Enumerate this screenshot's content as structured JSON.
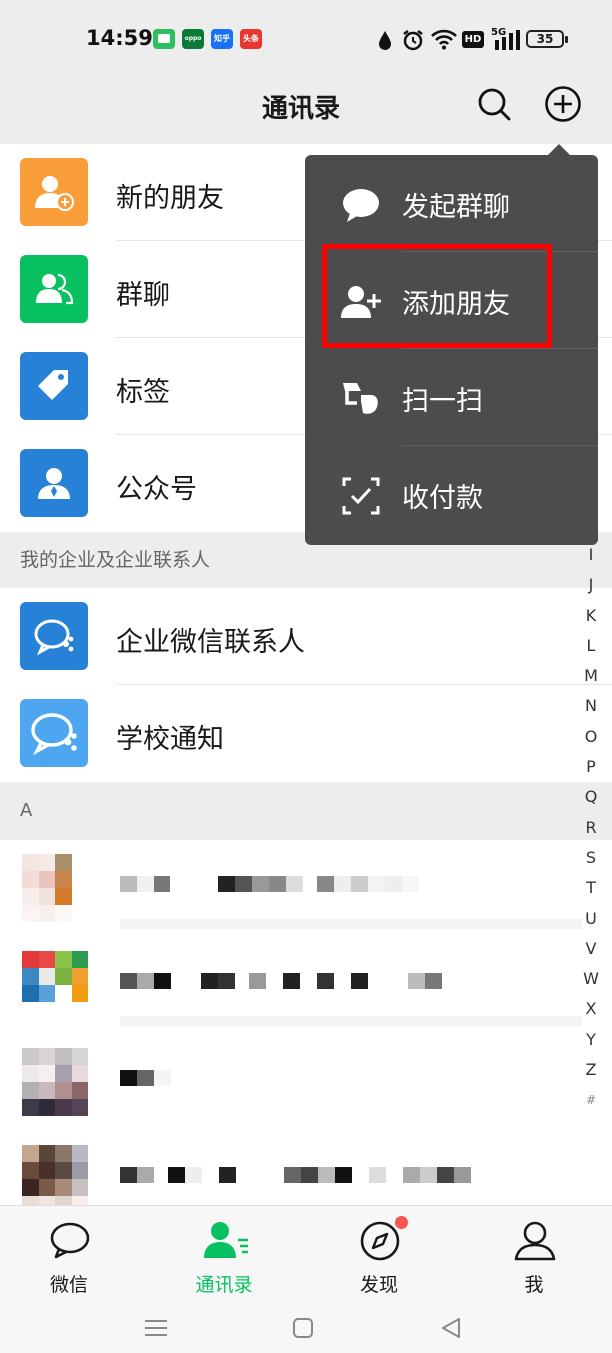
{
  "status_bar": {
    "time": "14:59",
    "apps": [
      {
        "name": "messages-icon",
        "label": "",
        "color": "#2dbe60"
      },
      {
        "name": "oppo-icon",
        "label": "oppo",
        "color": "#0a7a3a"
      },
      {
        "name": "zhihu-icon",
        "label": "知乎",
        "color": "#1772f6"
      },
      {
        "name": "toutiao-icon",
        "label": "头条",
        "color": "#e8352e"
      }
    ],
    "hd_label": "HD",
    "network": "5G",
    "battery": "35"
  },
  "header": {
    "title": "通讯录"
  },
  "top_items": [
    {
      "label": "新的朋友",
      "icon": "new-friend-icon",
      "color": "#fa9d3b"
    },
    {
      "label": "群聊",
      "icon": "group-chat-icon",
      "color": "#07c160"
    },
    {
      "label": "标签",
      "icon": "tag-icon",
      "color": "#2782d7"
    },
    {
      "label": "公众号",
      "icon": "official-account-icon",
      "color": "#2782d7"
    }
  ],
  "enterprise_section": {
    "title": "我的企业及企业联系人",
    "items": [
      {
        "label": "企业微信联系人",
        "icon": "wecom-icon",
        "color": "#2782d7"
      },
      {
        "label": "学校通知",
        "icon": "school-notice-icon",
        "color": "#4ea5f0"
      }
    ]
  },
  "contacts_section": {
    "letter": "A"
  },
  "alphabet_index": [
    "I",
    "J",
    "K",
    "L",
    "M",
    "N",
    "O",
    "P",
    "Q",
    "R",
    "S",
    "T",
    "U",
    "V",
    "W",
    "X",
    "Y",
    "Z",
    "#"
  ],
  "popup_menu": {
    "items": [
      {
        "label": "发起群聊",
        "icon": "chat-bubble-icon"
      },
      {
        "label": "添加朋友",
        "icon": "add-friend-icon"
      },
      {
        "label": "扫一扫",
        "icon": "scan-icon"
      },
      {
        "label": "收付款",
        "icon": "payment-icon"
      }
    ],
    "highlighted_index": 1
  },
  "tabbar": {
    "tabs": [
      {
        "label": "微信",
        "icon": "chat-icon",
        "active": false
      },
      {
        "label": "通讯录",
        "icon": "contacts-icon",
        "active": true
      },
      {
        "label": "发现",
        "icon": "compass-icon",
        "active": false
      },
      {
        "label": "我",
        "icon": "profile-icon",
        "active": false
      }
    ]
  },
  "colors": {
    "accent": "#07c160",
    "popup_bg": "#4c4c4c",
    "highlight": "#ff0000",
    "badge": "#fa5151"
  }
}
